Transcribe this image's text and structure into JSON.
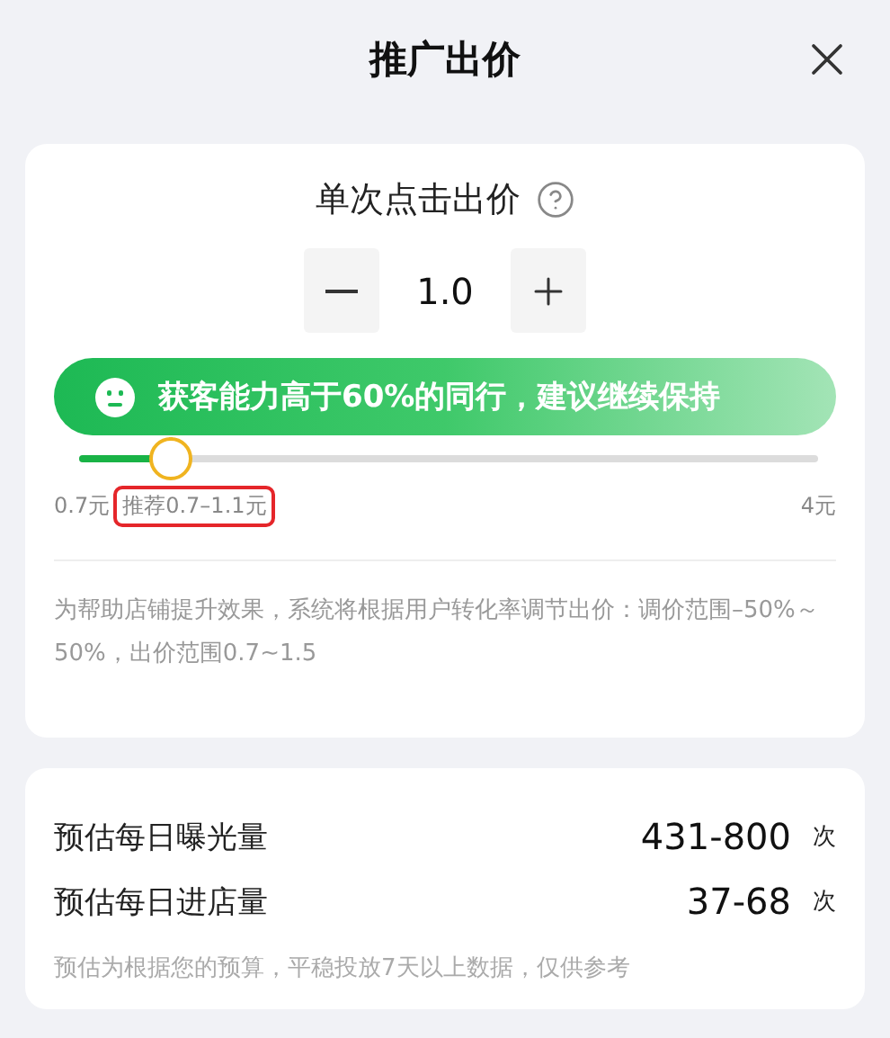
{
  "header": {
    "title": "推广出价"
  },
  "bid": {
    "label": "单次点击出价",
    "value": "1.0"
  },
  "banner": {
    "text": "获客能力高于60%的同行，建议继续保持"
  },
  "slider": {
    "level": 0.124,
    "min_label": "0.7元",
    "recommend_label": "推荐0.7–1.1元",
    "recommend_highlighted": true,
    "max_label": "4元"
  },
  "note": "为帮助店铺提升效果，系统将根据用户转化率调节出价：调价范围–50%～50%，出价范围0.7~1.5",
  "estimates": [
    {
      "label": "预估每日曝光量",
      "value": "431-800",
      "unit": "次"
    },
    {
      "label": "预估每日进店量",
      "value": "37-68",
      "unit": "次"
    }
  ],
  "estimate_note": "预估为根据您的预算，平稳投放7天以上数据，仅供参考"
}
